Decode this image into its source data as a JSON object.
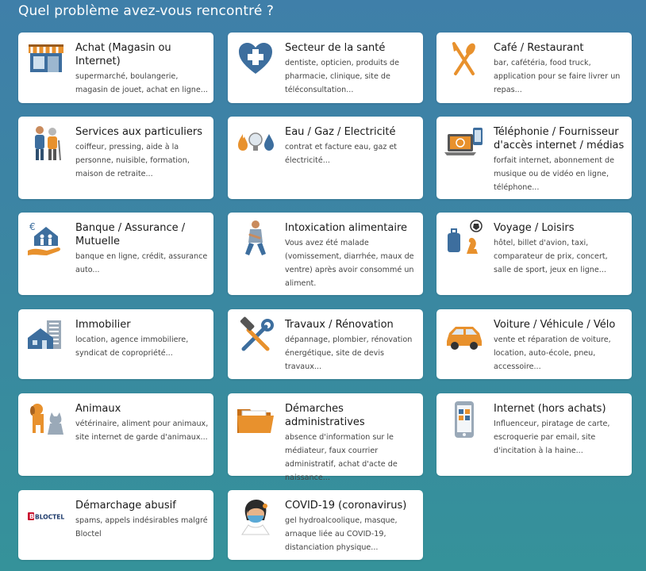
{
  "page": {
    "title": "Quel problème avez-vous rencontré ?"
  },
  "colors": {
    "accent_orange": "#e8912d",
    "icon_blue": "#3d6e9e",
    "background_top": "#3f7fa9",
    "background_bottom": "#35929a"
  },
  "cards": [
    {
      "title": "Achat (Magasin ou Internet)",
      "desc": "supermarché, boulangerie, magasin de jouet, achat en ligne...",
      "icon": "shop-icon"
    },
    {
      "title": "Secteur de la santé",
      "desc": "dentiste, opticien, produits de pharmacie, clinique, site de téléconsultation...",
      "icon": "health-heart-icon"
    },
    {
      "title": "Café / Restaurant",
      "desc": "bar, cafétéria, food truck, application pour se faire livrer un repas...",
      "icon": "fork-knife-icon"
    },
    {
      "title": "Services aux particuliers",
      "desc": "coiffeur, pressing, aide à la personne, nuisible, formation, maison de retraite...",
      "icon": "people-icon"
    },
    {
      "title": "Eau / Gaz / Electricité",
      "desc": "contrat et facture eau, gaz et électricité...",
      "icon": "utilities-icon"
    },
    {
      "title": "Téléphonie / Fournisseur d'accès internet / médias",
      "desc": "forfait internet, abonnement de musique ou de vidéo en ligne, téléphone...",
      "icon": "laptop-phone-icon"
    },
    {
      "title": "Banque / Assurance / Mutuelle",
      "desc": "banque en ligne, crédit, assurance auto...",
      "icon": "bank-house-hand-icon"
    },
    {
      "title": "Intoxication alimentaire",
      "desc": "Vous avez été malade (vomissement, diarrhée, maux de ventre) après avoir consommé un aliment.",
      "icon": "sick-person-icon"
    },
    {
      "title": "Voyage / Loisirs",
      "desc": "hôtel, billet d'avion, taxi, comparateur de prix, concert, salle de sport, jeux en ligne...",
      "icon": "travel-leisure-icon"
    },
    {
      "title": "Immobilier",
      "desc": "location, agence immobiliere, syndicat de copropriété...",
      "icon": "buildings-icon"
    },
    {
      "title": "Travaux / Rénovation",
      "desc": "dépannage, plombier, rénovation énergétique, site de devis travaux...",
      "icon": "hammer-wrench-icon"
    },
    {
      "title": "Voiture / Véhicule / Vélo",
      "desc": "vente et réparation de voiture, location, auto-école, pneu, accessoire...",
      "icon": "car-icon"
    },
    {
      "title": "Animaux",
      "desc": "vétérinaire, aliment pour animaux, site internet de garde d'animaux...",
      "icon": "dog-cat-icon"
    },
    {
      "title": "Démarches administratives",
      "desc": "absence d'information sur le médiateur, faux courrier administratif, achat d'acte de naissance...",
      "icon": "folder-icon"
    },
    {
      "title": "Internet (hors achats)",
      "desc": "Influenceur, piratage de carte, escroquerie par email, site d'incitation à la haine...",
      "icon": "smartphone-icon"
    },
    {
      "title": "Démarchage abusif",
      "desc": "spams, appels indésirables malgré Bloctel",
      "icon": "bloctel-logo-icon",
      "logo_text": "BLOCTEL"
    },
    {
      "title": "COVID-19 (coronavirus)",
      "desc": "gel hydroalcoolique, masque, arnaque liée au COVID-19, distanciation physique...",
      "icon": "masked-person-icon"
    }
  ]
}
